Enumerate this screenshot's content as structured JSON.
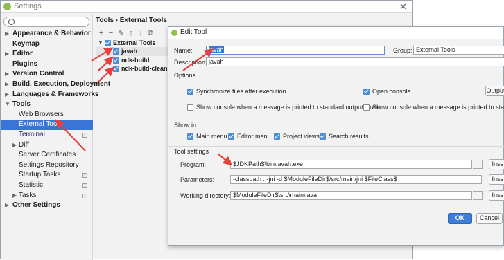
{
  "settings_window": {
    "title": "Settings",
    "close_glyph": "✕"
  },
  "sidebar": {
    "search_placeholder": "",
    "items": [
      {
        "label": "Appearance & Behavior",
        "bold": true,
        "arrow": "▶"
      },
      {
        "label": "Keymap",
        "bold": true,
        "arrow": ""
      },
      {
        "label": "Editor",
        "bold": true,
        "arrow": "▶"
      },
      {
        "label": "Plugins",
        "bold": true,
        "arrow": ""
      },
      {
        "label": "Version Control",
        "bold": true,
        "arrow": "▶"
      },
      {
        "label": "Build, Execution, Deployment",
        "bold": true,
        "arrow": "▶"
      },
      {
        "label": "Languages & Frameworks",
        "bold": true,
        "arrow": "▶"
      },
      {
        "label": "Tools",
        "bold": true,
        "arrow": "▼"
      },
      {
        "label": "Web Browsers",
        "bold": false,
        "arrow": ""
      },
      {
        "label": "External Tools",
        "bold": false,
        "arrow": ""
      },
      {
        "label": "Terminal",
        "bold": false,
        "arrow": ""
      },
      {
        "label": "Diff",
        "bold": false,
        "arrow": "▶"
      },
      {
        "label": "Server Certificates",
        "bold": false,
        "arrow": ""
      },
      {
        "label": "Settings Repository",
        "bold": false,
        "arrow": ""
      },
      {
        "label": "Startup Tasks",
        "bold": false,
        "arrow": ""
      },
      {
        "label": "Statistic",
        "bold": false,
        "arrow": ""
      },
      {
        "label": "Tasks",
        "bold": false,
        "arrow": "▶"
      },
      {
        "label": "Other Settings",
        "bold": true,
        "arrow": "▶"
      }
    ]
  },
  "breadcrumb": "Tools › External Tools",
  "toolbar": {
    "add": "+",
    "remove": "−",
    "edit": "✎",
    "move_up": "↑",
    "move_down": "↓",
    "copy": "⧉"
  },
  "tools_tree": {
    "group": "External Tools",
    "items": [
      "javah",
      "ndk-build",
      "ndk-build-clean"
    ]
  },
  "dialog": {
    "title": "Edit Tool",
    "name_label": "Name:",
    "name_value": "javah",
    "group_label": "Group:",
    "group_value": "External Tools",
    "description_label": "Description:",
    "description_value": "javah",
    "options_header": "Options",
    "options": {
      "sync_files": "Synchronize files after execution",
      "open_console": "Open console",
      "output_filters_button": "Output",
      "show_console_stdout": "Show console when a message is printed to standard output stream",
      "show_console_stderr": "Show console when a message is printed to standard er"
    },
    "show_in_header": "Show in",
    "show_in": {
      "main_menu": "Main menu",
      "editor_menu": "Editor menu",
      "project_views": "Project views",
      "search_results": "Search results"
    },
    "tool_settings_header": "Tool settings",
    "program_label": "Program:",
    "program_value": "$JDKPath$\\bin\\javah.exe",
    "parameters_label": "Parameters:",
    "parameters_value": "-classpath . -jni -d $ModuleFileDir$/src/main/jni $FileClass$",
    "working_dir_label": "Working directory:",
    "working_dir_value": "$ModuleFileDir$\\src\\main\\java",
    "browse_label": "...",
    "insert_macro_label": "Inse",
    "ok_label": "OK",
    "cancel_label": "Cancel"
  },
  "colors": {
    "accent": "#3875d7",
    "checkbox": "#4d8fd6",
    "annotation_arrow": "#e8413c"
  }
}
